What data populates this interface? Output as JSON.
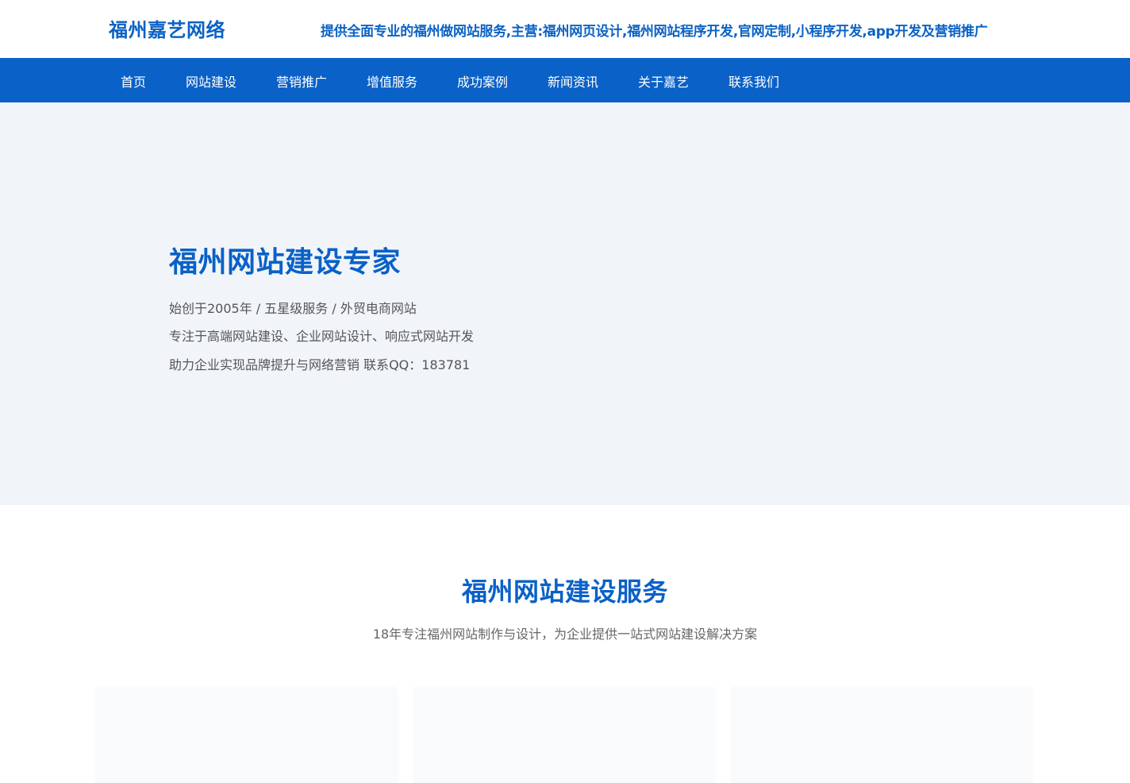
{
  "header": {
    "logo": "福州嘉艺网络",
    "tagline": "提供全面专业的福州做网站服务,主营:福州网页设计,福州网站程序开发,官网定制,小程序开发,app开发及营销推广"
  },
  "nav": {
    "items": [
      {
        "label": "首页"
      },
      {
        "label": "网站建设"
      },
      {
        "label": "营销推广"
      },
      {
        "label": "增值服务"
      },
      {
        "label": "成功案例"
      },
      {
        "label": "新闻资讯"
      },
      {
        "label": "关于嘉艺"
      },
      {
        "label": "联系我们"
      }
    ]
  },
  "hero": {
    "title": "福州网站建设专家",
    "lines": [
      "始创于2005年 / 五星级服务 / 外贸电商网站",
      "专注于高端网站建设、企业网站设计、响应式网站开发",
      "助力企业实现品牌提升与网络营销 联系QQ：183781"
    ]
  },
  "services": {
    "title": "福州网站建设服务",
    "subtitle": "18年专注福州网站制作与设计，为企业提供一站式网站建设解决方案"
  },
  "colors": {
    "brand": "#0a61c7",
    "hero_bg": "#f1f5f9",
    "text_muted": "#555555"
  }
}
